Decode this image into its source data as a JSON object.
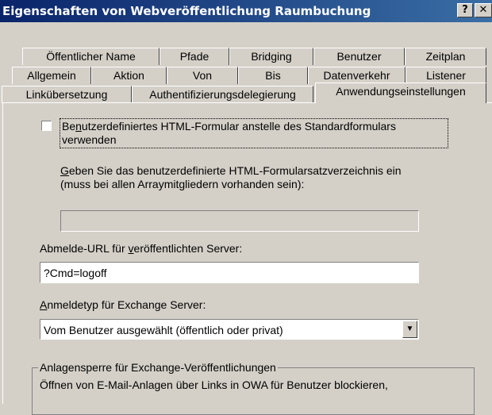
{
  "window": {
    "title": "Eigenschaften von Webveröffentlichung Raumbuchung",
    "help_label": "?",
    "close_label": "✕"
  },
  "tabs": {
    "row1": [
      "Öffentlicher Name",
      "Pfade",
      "Bridging",
      "Benutzer",
      "Zeitplan"
    ],
    "row2": [
      "Allgemein",
      "Aktion",
      "Von",
      "Bis",
      "Datenverkehr",
      "Listener"
    ],
    "row3": [
      "Linkübersetzung",
      "Authentifizierungsdelegierung",
      "Anwendungseinstellungen"
    ],
    "active": "Anwendungseinstellungen"
  },
  "custom_form": {
    "checkbox_label_pre": "Be",
    "checkbox_label_u": "n",
    "checkbox_label_post": "utzerdefiniertes HTML-Formular anstelle des Standardformulars",
    "checkbox_label_line2": "verwenden",
    "checked": false,
    "dir_prompt_u": "G",
    "dir_prompt_post": "eben Sie das benutzerdefinierte HTML-Formularsatzverzeichnis ein",
    "dir_prompt_line2": "(muss bei allen Arraymitgliedern vorhanden sein):",
    "dir_value": ""
  },
  "logoff": {
    "label_pre": "Abmelde-URL für ",
    "label_u": "v",
    "label_post": "eröffentlichten Server:",
    "value": "?Cmd=logoff"
  },
  "logon_type": {
    "label_u": "A",
    "label_post": "nmeldetyp für Exchange Server:",
    "selected": "Vom Benutzer ausgewählt (öffentlich oder privat)",
    "dropdown_icon": "triangle-down-icon"
  },
  "attachment_lock": {
    "group_title": "Anlagensperre für Exchange-Veröffentlichungen",
    "text": "Öffnen von E-Mail-Anlagen über Links in OWA für Benutzer blockieren,"
  },
  "colors": {
    "titlebar_start": "#0a246a",
    "titlebar_end": "#3a6ea5",
    "face": "#d4d0c8"
  }
}
